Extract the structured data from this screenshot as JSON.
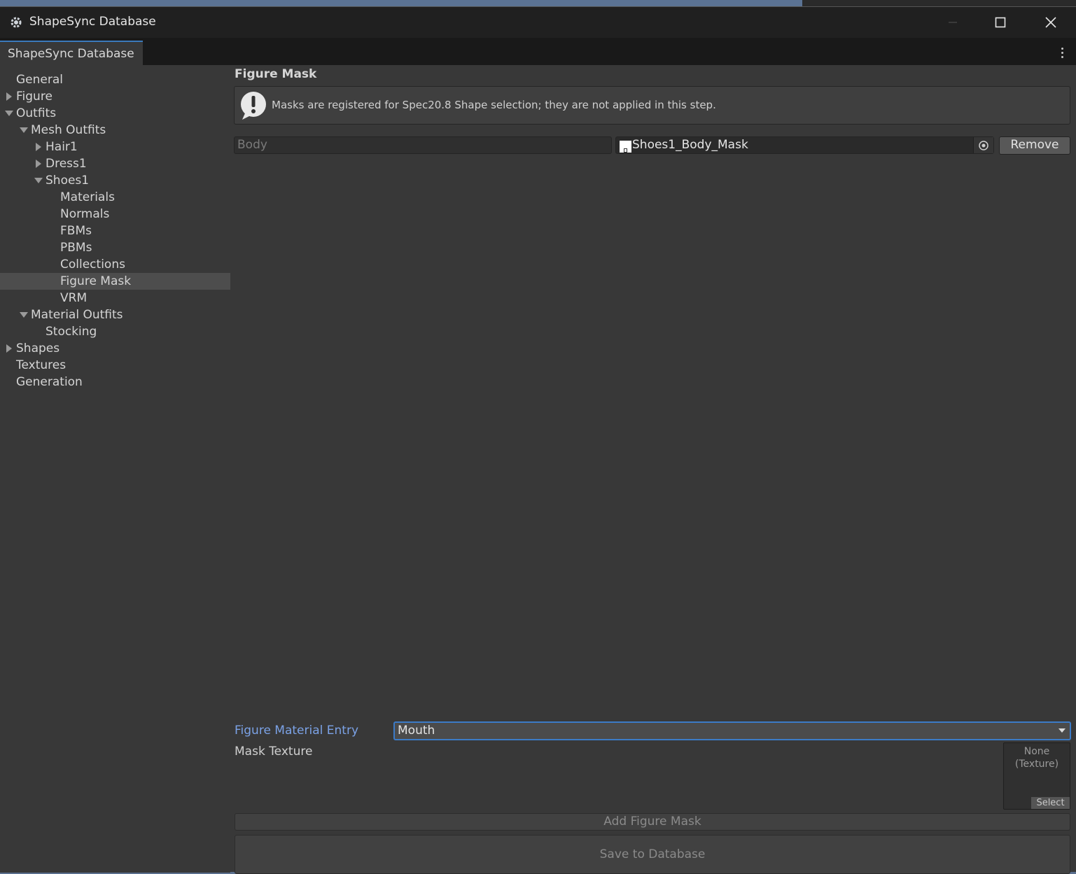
{
  "window": {
    "title": "ShapeSync Database",
    "tab_label": "ShapeSync Database"
  },
  "sidebar": {
    "items": [
      {
        "label": "General",
        "arrow": "none"
      },
      {
        "label": "Figure",
        "arrow": "collapsed"
      },
      {
        "label": "Outfits",
        "arrow": "expanded"
      },
      {
        "label": "Mesh Outfits",
        "arrow": "expanded"
      },
      {
        "label": "Hair1",
        "arrow": "collapsed"
      },
      {
        "label": "Dress1",
        "arrow": "collapsed"
      },
      {
        "label": "Shoes1",
        "arrow": "expanded"
      },
      {
        "label": "Materials",
        "arrow": "none"
      },
      {
        "label": "Normals",
        "arrow": "none"
      },
      {
        "label": "FBMs",
        "arrow": "none"
      },
      {
        "label": "PBMs",
        "arrow": "none"
      },
      {
        "label": "Collections",
        "arrow": "none"
      },
      {
        "label": "Figure Mask",
        "arrow": "none",
        "selected": true
      },
      {
        "label": "VRM",
        "arrow": "none"
      },
      {
        "label": "Material Outfits",
        "arrow": "expanded"
      },
      {
        "label": "Stocking",
        "arrow": "none"
      },
      {
        "label": "Shapes",
        "arrow": "collapsed"
      },
      {
        "label": "Textures",
        "arrow": "none"
      },
      {
        "label": "Generation",
        "arrow": "none"
      }
    ]
  },
  "main": {
    "section_title": "Figure Mask",
    "help_message": "Masks are registered for Spec20.8 Shape selection; they are not applied in this step.",
    "mask_entry": {
      "material_placeholder": "Body",
      "texture_name": "Shoes1_Body_Mask",
      "remove_label": "Remove"
    },
    "figure_material_entry_label": "Figure Material Entry",
    "figure_material_entry_value": "Mouth",
    "mask_texture_label": "Mask Texture",
    "texture_slot": {
      "none_text": "None\n(Texture)",
      "select_label": "Select"
    },
    "add_button": "Add Figure Mask",
    "save_button": "Save to Database"
  },
  "colors": {
    "accent": "#3c7bc7",
    "label_blue": "#7ba2e6",
    "panel_bg": "#383838"
  },
  "icons": {
    "app": "unity-gear-icon",
    "warning": "exclamation-icon",
    "picker": "object-picker-icon",
    "more": "kebab-menu-icon"
  }
}
